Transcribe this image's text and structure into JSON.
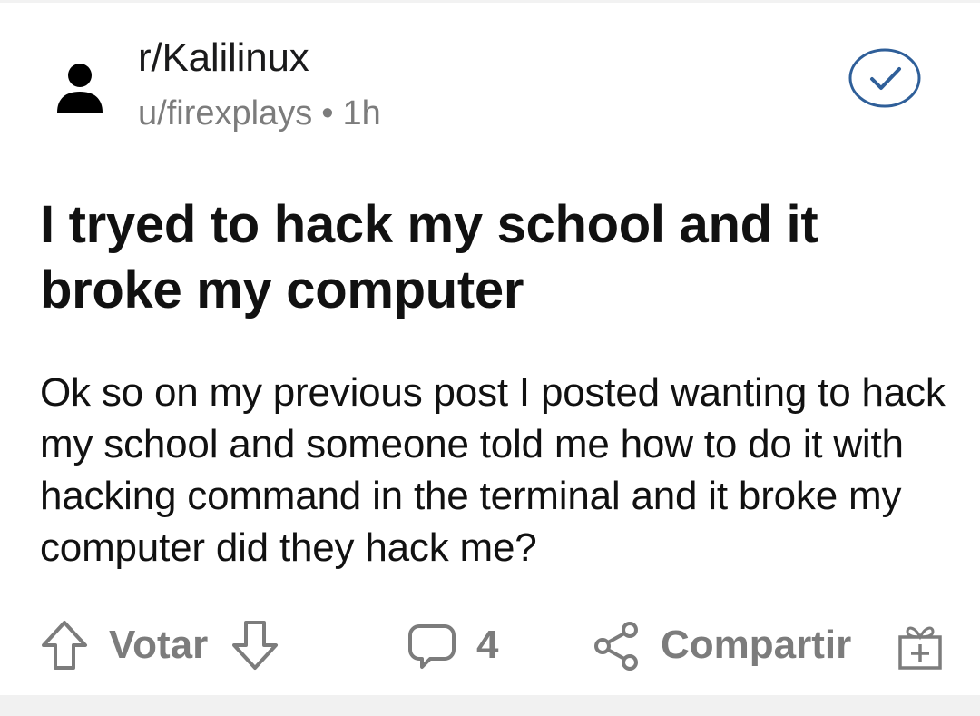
{
  "post": {
    "subreddit": "r/Kalilinux",
    "author": "u/firexplays",
    "separator": "•",
    "age": "1h",
    "title": "I tryed to hack my school and it broke my computer",
    "body": "Ok so on my previous post I posted wanting to hack my school and someone told me how to do it with hacking command in the terminal and it broke my computer did they hack me?"
  },
  "actions": {
    "vote_label": "Votar",
    "comment_count": "4",
    "share_label": "Compartir"
  },
  "icons": {
    "avatar": "person-icon",
    "joined": "check-circle-icon",
    "upvote": "arrow-up-icon",
    "downvote": "arrow-down-icon",
    "comment": "speech-bubble-icon",
    "share": "share-icon",
    "award": "gift-icon"
  },
  "colors": {
    "text_primary": "#111111",
    "text_secondary": "#7c7c7c",
    "accent": "#2f5f99"
  }
}
